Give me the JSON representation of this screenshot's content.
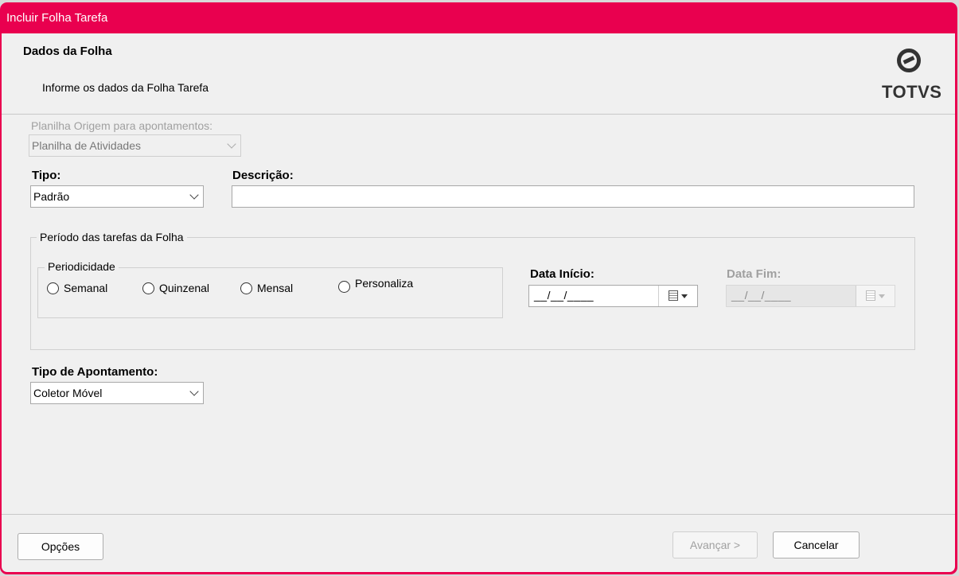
{
  "window": {
    "title": "Incluir Folha Tarefa",
    "accent": "#e9004f"
  },
  "header": {
    "title": "Dados da Folha",
    "subtitle": "Informe os dados da Folha Tarefa",
    "logo_text": "TOTVS"
  },
  "form": {
    "planilha_label": "Planilha Origem para apontamentos:",
    "planilha_value": "Planilha de Atividades",
    "tipo_label": "Tipo:",
    "tipo_value": "Padrão",
    "descricao_label": "Descrição:",
    "descricao_value": "",
    "periodo_group": "Período das tarefas da Folha",
    "periodicidade_group": "Periodicidade",
    "radios": [
      "Semanal",
      "Quinzenal",
      "Mensal",
      "Personaliza"
    ],
    "data_inicio_label": "Data Início:",
    "data_inicio_value": "__/__/____",
    "data_fim_label": "Data Fim:",
    "data_fim_value": "__/__/____",
    "tipo_apontamento_label": "Tipo de Apontamento:",
    "tipo_apontamento_value": "Coletor Móvel"
  },
  "footer": {
    "opcoes": "Opções",
    "avancar": "Avançar >",
    "cancelar": "Cancelar"
  }
}
